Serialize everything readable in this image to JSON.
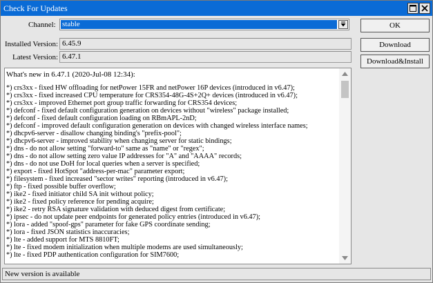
{
  "window": {
    "title": "Check For Updates"
  },
  "channel": {
    "label": "Channel:",
    "value": "stable"
  },
  "installed_version": {
    "label": "Installed Version:",
    "value": "6.45.9"
  },
  "latest_version": {
    "label": "Latest Version:",
    "value": "6.47.1"
  },
  "buttons": {
    "ok": "OK",
    "download": "Download",
    "download_install": "Download&Install"
  },
  "notes": {
    "header": "What's new in 6.47.1 (2020-Jul-08 12:34):",
    "lines": [
      "*) crs3xx - fixed HW offloading for netPower 15FR and netPower 16P devices (introduced in v6.47);",
      "*) crs3xx - fixed increased CPU temperature for CRS354-48G-4S+2Q+ devices (introduced in v6.47);",
      "*) crs3xx - improved Ethernet port group traffic forwarding for CRS354 devices;",
      "*) defconf - fixed default configuration generation on devices without \"wireless\" package installed;",
      "*) defconf - fixed default configuration loading on RBmAPL-2nD;",
      "*) defconf - improved default configuration generation on devices with changed wireless interface names;",
      "*) dhcpv6-server - disallow changing binding's \"prefix-pool\";",
      "*) dhcpv6-server - improved stability when changing server for static bindings;",
      "*) dns - do not allow setting \"forward-to\" same as \"name\" or \"regex\";",
      "*) dns - do not allow setting zero value IP addresses for \"A\" and \"AAAA\" records;",
      "*) dns - do not use DoH for local queries when a server is specified;",
      "*) export - fixed HotSpot \"address-per-mac\" parameter export;",
      "*) filesystem - fixed increased \"sector writes\" reporting (introduced in v6.47);",
      "*) ftp - fixed possible buffer overflow;",
      "*) ike2 - fixed initiator child SA init without policy;",
      "*) ike2 - fixed policy reference for pending acquire;",
      "*) ike2 - retry RSA signature validation with deduced digest from certificate;",
      "*) ipsec - do not update peer endpoints for generated policy entries (introduced in v6.47);",
      "*) lora - added \"spoof-gps\" parameter for fake GPS coordinate sending;",
      "*) lora - fixed JSON statistics inaccuracies;",
      "*) lte - added support for MTS 8810FT;",
      "*) lte - fixed modem initialization when multiple modems are used simultaneously;",
      "*) lte - fixed PDP authentication configuration for SIM7600;"
    ]
  },
  "status": {
    "text": "New version is available"
  },
  "colors": {
    "titlebar": "#0a6bd6",
    "selection": "#0a6bd6",
    "background": "#e6e6e6"
  },
  "icons": {
    "maximize": "maximize-icon",
    "close": "close-icon",
    "dropdown": "dropdown-arrow-icon"
  }
}
